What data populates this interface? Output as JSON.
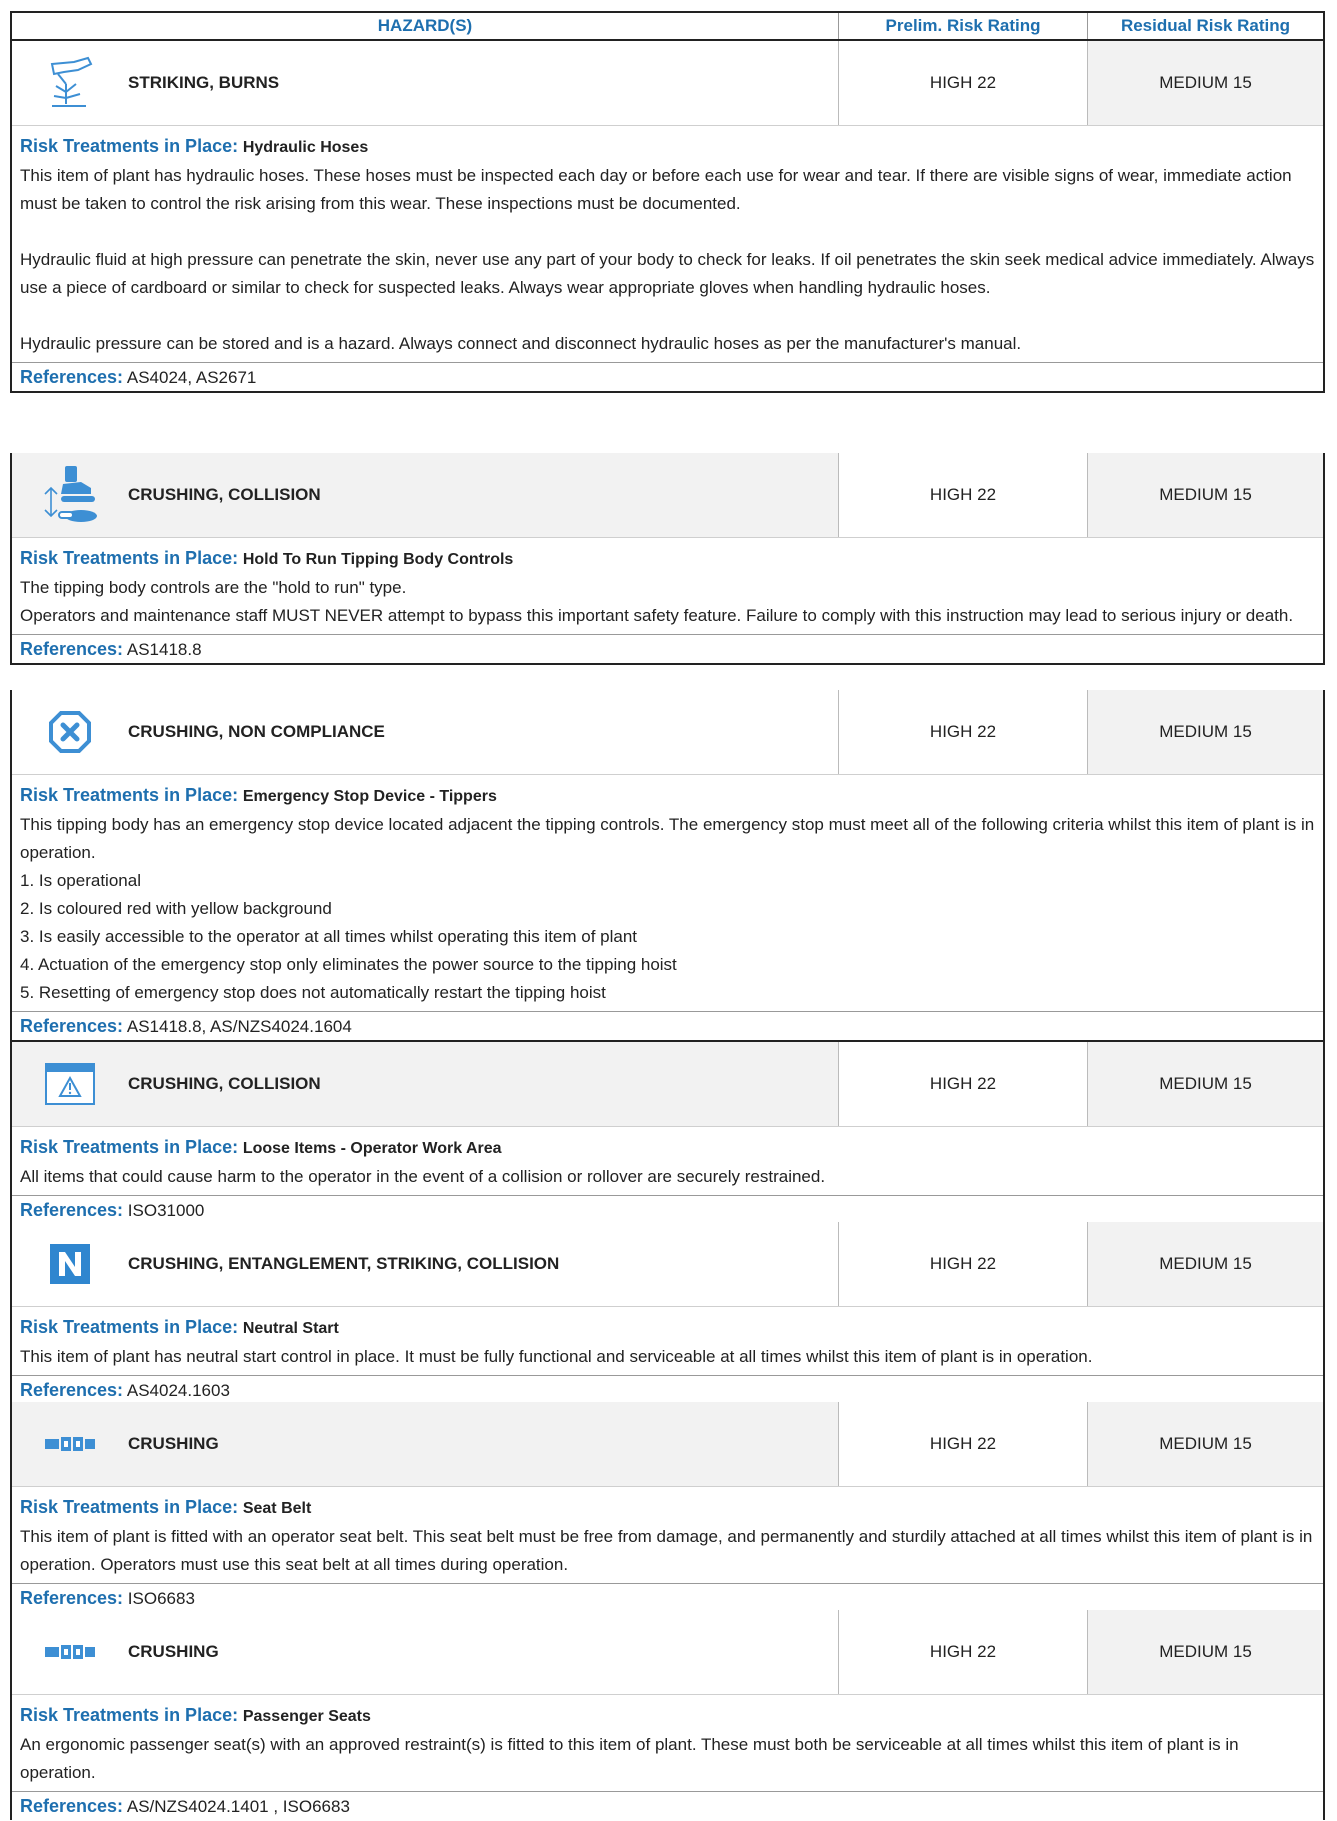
{
  "header": {
    "hazard_label": "HAZARD(S)",
    "prelim_label": "Prelim. Risk Rating",
    "residual_label": "Residual Risk Rating"
  },
  "labels": {
    "treatments_label": "Risk Treatments in Place:",
    "references_label": "References:"
  },
  "colors": {
    "accent": "#1e6faf",
    "icon": "#3d8fd4",
    "border": "#222222",
    "row_bg": "#f2f2f2"
  },
  "hazards": [
    {
      "icon": "hand-hose-spray-icon",
      "name": "STRIKING, BURNS",
      "prelim": "HIGH 22",
      "residual": "MEDIUM 15",
      "treatment_name": "Hydraulic Hoses",
      "paragraphs": [
        "This item of plant has hydraulic hoses. These hoses must be inspected each day or before each use for wear and tear. If there are visible signs of wear, immediate action must be taken to control the risk arising from this wear. These inspections must be documented.",
        "Hydraulic fluid at high pressure can penetrate the skin, never use any part of your body to check for leaks. If oil penetrates the skin seek medical advice immediately. Always use a piece of cardboard or similar to check for suspected leaks. Always wear appropriate gloves when handling hydraulic hoses.",
        "Hydraulic pressure can be stored and is a hazard. Always connect and disconnect hydraulic hoses as per the manufacturer's manual."
      ],
      "references": "AS4024, AS2671"
    },
    {
      "icon": "excavator-hold-to-run-icon",
      "name": "CRUSHING, COLLISION",
      "prelim": "HIGH 22",
      "residual": "MEDIUM 15",
      "treatment_name": "Hold To Run Tipping Body Controls",
      "paragraphs": [
        "The tipping body controls are the \"hold to run\" type.",
        "Operators and maintenance staff MUST NEVER attempt to bypass this important safety feature. Failure to comply with this instruction may lead to serious injury or death."
      ],
      "references": "AS1418.8"
    },
    {
      "icon": "emergency-stop-icon",
      "name": "CRUSHING, NON COMPLIANCE",
      "prelim": "HIGH 22",
      "residual": "MEDIUM 15",
      "treatment_name": "Emergency Stop Device - Tippers",
      "paragraphs": [
        "This tipping body has an emergency stop device located adjacent the tipping controls. The emergency stop must meet all of the following criteria whilst this item of plant is in operation.",
        "1. Is operational",
        "2. Is coloured red with yellow background",
        "3. Is easily accessible to the operator at all times whilst operating this item of plant",
        "4. Actuation of the emergency stop only eliminates the power source to the tipping hoist",
        "5. Resetting of emergency stop does not automatically restart the tipping hoist"
      ],
      "references": "AS1418.8, AS/NZS4024.1604"
    },
    {
      "icon": "window-warning-icon",
      "name": "CRUSHING, COLLISION",
      "prelim": "HIGH 22",
      "residual": "MEDIUM 15",
      "treatment_name": "Loose Items - Operator Work Area",
      "paragraphs": [
        "All items that could cause harm to the operator in the event of a collision or rollover are securely restrained."
      ],
      "references": "ISO31000"
    },
    {
      "icon": "neutral-n-icon",
      "name": "CRUSHING, ENTANGLEMENT, STRIKING, COLLISION",
      "prelim": "HIGH 22",
      "residual": "MEDIUM 15",
      "treatment_name": "Neutral Start",
      "paragraphs": [
        "This item of plant has neutral start control in place. It must be fully functional and serviceable at all times whilst this item of plant is in operation."
      ],
      "references": "AS4024.1603"
    },
    {
      "icon": "seat-belt-icon",
      "name": "CRUSHING",
      "prelim": "HIGH 22",
      "residual": "MEDIUM 15",
      "treatment_name": "Seat Belt",
      "paragraphs": [
        "This item of plant is fitted with an operator seat belt. This seat belt must be free from damage, and permanently and sturdily attached at all times whilst this item of plant is in operation. Operators must use this seat belt at all times during operation."
      ],
      "references": "ISO6683"
    },
    {
      "icon": "seat-belt-icon",
      "name": "CRUSHING",
      "prelim": "HIGH 22",
      "residual": "MEDIUM 15",
      "treatment_name": "Passenger Seats",
      "paragraphs": [
        "An ergonomic passenger seat(s) with an approved restraint(s) is fitted to this item of plant. These must both be serviceable at all times whilst this item of plant is in operation."
      ],
      "references": "AS/NZS4024.1401 , ISO6683"
    }
  ]
}
